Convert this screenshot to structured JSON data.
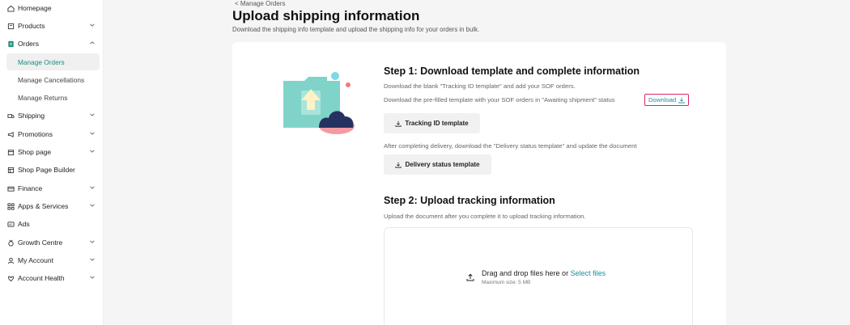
{
  "sidebar": {
    "items": [
      {
        "label": "Homepage",
        "icon": "home-icon",
        "chevron": "",
        "top": 0
      },
      {
        "label": "Products",
        "icon": "products-icon",
        "chevron": "down"
      },
      {
        "label": "Orders",
        "icon": "orders-icon",
        "chevron": "up"
      },
      {
        "label": "Shipping",
        "icon": "truck-icon",
        "chevron": "down"
      },
      {
        "label": "Promotions",
        "icon": "megaphone-icon",
        "chevron": "down"
      },
      {
        "label": "Shop page",
        "icon": "shop-icon",
        "chevron": "down"
      },
      {
        "label": "Shop Page Builder",
        "icon": "builder-icon",
        "chevron": ""
      },
      {
        "label": "Finance",
        "icon": "wallet-icon",
        "chevron": "down"
      },
      {
        "label": "Apps & Services",
        "icon": "apps-icon",
        "chevron": "down"
      },
      {
        "label": "Ads",
        "icon": "ads-icon",
        "chevron": ""
      },
      {
        "label": "Growth Centre",
        "icon": "medal-icon",
        "chevron": "down"
      },
      {
        "label": "My Account",
        "icon": "user-icon",
        "chevron": "down"
      },
      {
        "label": "Account Health",
        "icon": "shield-icon",
        "chevron": "down"
      }
    ],
    "orders_sub": [
      {
        "label": "Manage Orders",
        "active": true
      },
      {
        "label": "Manage Cancellations",
        "active": false
      },
      {
        "label": "Manage Returns",
        "active": false
      }
    ]
  },
  "header": {
    "back": "< Manage Orders",
    "title": "Upload shipping information",
    "subtitle": "Download the shipping info template and upload the shipping info for your orders in bulk."
  },
  "step1": {
    "title": "Step 1: Download template and complete information",
    "line1": "Download the blank \"Tracking ID template\" and add your SOF orders.",
    "line2": "Download the pre-filled template with your SOF orders in \"Awaiting shipment\" status",
    "download_link": "Download",
    "tracking_btn": "Tracking ID template",
    "line3": "After completing delivery, download the \"Delivery status template\" and update the document",
    "delivery_btn": "Delivery status template"
  },
  "step2": {
    "title": "Step 2: Upload tracking information",
    "line1": "Upload the document after you complete it to upload tracking information.",
    "drop_text": "Drag and drop files here or ",
    "select_link": "Select files",
    "max_size": "Maximum size: 5 MB"
  },
  "colors": {
    "accent": "#1a8d9d",
    "highlight_border": "#e0245e",
    "folder": "#7fd3c9",
    "cloud_dark": "#253260",
    "cloud_pink": "#f29ba2"
  }
}
